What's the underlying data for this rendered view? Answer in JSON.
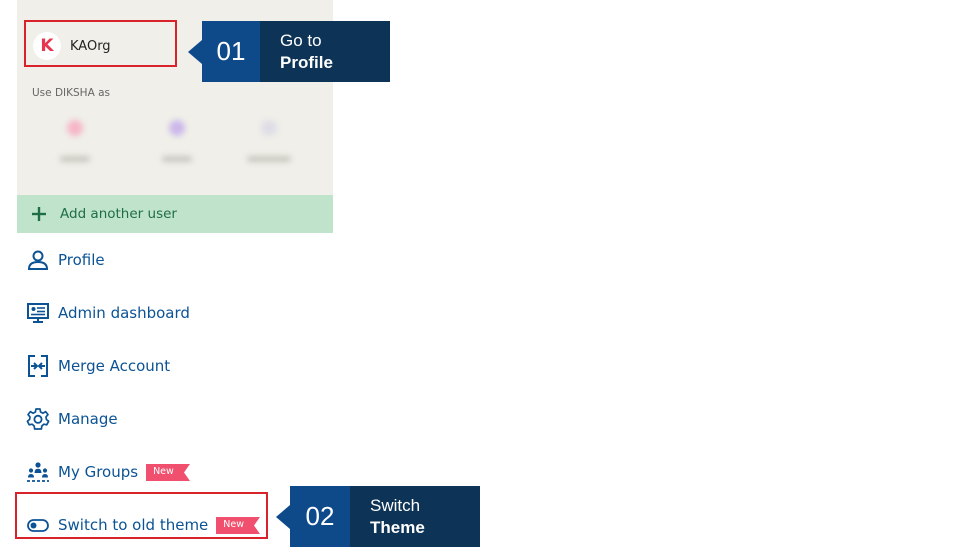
{
  "user_panel": {
    "user_name": "KAOrg",
    "avatar_letter": "K",
    "use_as_label": "Use DIKSHA as",
    "add_user_label": "Add another user"
  },
  "menu": {
    "items": [
      {
        "label": "Profile",
        "icon": "person-icon"
      },
      {
        "label": "Admin dashboard",
        "icon": "dashboard-icon"
      },
      {
        "label": "Merge Account",
        "icon": "merge-icon"
      },
      {
        "label": "Manage",
        "icon": "gear-icon"
      },
      {
        "label": "My Groups",
        "icon": "groups-icon",
        "badge": "New"
      },
      {
        "label": "Switch to old theme",
        "icon": "toggle-icon",
        "badge": "New"
      }
    ]
  },
  "callouts": [
    {
      "number": "01",
      "line1": "Go to",
      "line2": "Profile"
    },
    {
      "number": "02",
      "line1": "Switch",
      "line2": "Theme"
    }
  ],
  "colors": {
    "accent_blue": "#0b5395",
    "badge_red": "#f0506e",
    "add_user_bg": "#c0e3cc",
    "highlight_red": "#d9232a",
    "callout_number_bg": "#0e4a8a",
    "callout_text_bg": "#0d3456"
  }
}
